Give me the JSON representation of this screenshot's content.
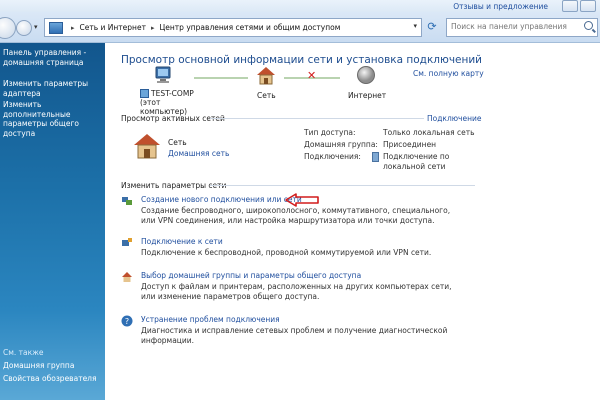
{
  "window": {
    "feedback_link": "Отзывы и предложение"
  },
  "address_bar": {
    "crumbs": [
      "Сеть и Интернет",
      "Центр управления сетями и общим доступом"
    ],
    "search_placeholder": "Поиск на панели управления"
  },
  "sidebar": {
    "links": [
      "Панель управления -\nдомашняя страница",
      "Изменить параметры\nадаптера",
      "Изменить дополнительные\nпараметры общего доступа"
    ],
    "see_also_label": "См. также",
    "see_also_links": [
      "Домашняя группа",
      "Свойства обозревателя"
    ]
  },
  "main": {
    "title": "Просмотр основной информации сети и установка подключений",
    "full_map_link": "См. полную карту",
    "map": {
      "computer_name": "TEST-COMP",
      "computer_sub": "(этот компьютер)",
      "network_label": "Сеть",
      "internet_label": "Интернет"
    },
    "active_networks": {
      "header": "Просмотр активных сетей",
      "connect_link": "Подключение",
      "network_name": "Сеть",
      "network_type": "Домашняя сеть",
      "access_type_label": "Тип доступа:",
      "access_type_value": "Только локальная сеть",
      "homegroup_label": "Домашняя группа:",
      "homegroup_value": "Присоединен",
      "connections_label": "Подключения:",
      "connections_value_line1": "Подключение по",
      "connections_value_line2": "локальной сети"
    },
    "change_settings": {
      "header": "Изменить параметры сети",
      "tasks": [
        {
          "link": "Создание нового подключения или сети",
          "desc": "Создание беспроводного, широкополосного, коммутативного, специального, или VPN соединения, или настройка маршрутизатора или точки доступа."
        },
        {
          "link": "Подключение к сети",
          "desc": "Подключение к беспроводной, проводной коммутируемой или VPN сети."
        },
        {
          "link": "Выбор домашней группы и параметры общего доступа",
          "desc": "Доступ к файлам и принтерам, расположенных на других компьютерах сети, или изменение параметров общего доступа."
        },
        {
          "link": "Устранение проблем подключения",
          "desc": "Диагностика и исправление сетевых проблем и получение диагностической информации."
        }
      ]
    }
  },
  "colors": {
    "link": "#1f4e9e",
    "title": "#1e4d8f",
    "sidebar_top": "#12568d",
    "sidebar_bottom": "#5aa8d6",
    "arrow": "#d21c1c"
  },
  "icons": [
    "computer-icon",
    "house-icon",
    "globe-icon",
    "network-task-icon",
    "connect-icon",
    "homegroup-icon",
    "help-icon",
    "search-icon",
    "refresh-icon"
  ]
}
